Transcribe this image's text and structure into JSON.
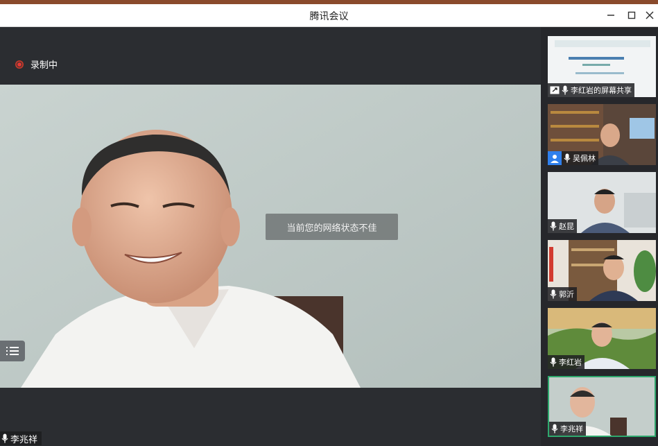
{
  "window": {
    "title": "腾讯会议"
  },
  "recording": {
    "label": "录制中"
  },
  "main_video": {
    "notice": "当前您的网络状态不佳",
    "speaker_name": "李兆祥"
  },
  "participants": [
    {
      "name": "李红岩的屏幕共享",
      "kind": "screen-share"
    },
    {
      "name": "吴佩林",
      "kind": "host"
    },
    {
      "name": "赵昆"
    },
    {
      "name": "郭沂"
    },
    {
      "name": "李红岩"
    },
    {
      "name": "李兆祥",
      "active": true
    }
  ],
  "colors": {
    "accent_active": "#2ea86d",
    "recording": "#e53935",
    "host_badge": "#2f80ed"
  }
}
